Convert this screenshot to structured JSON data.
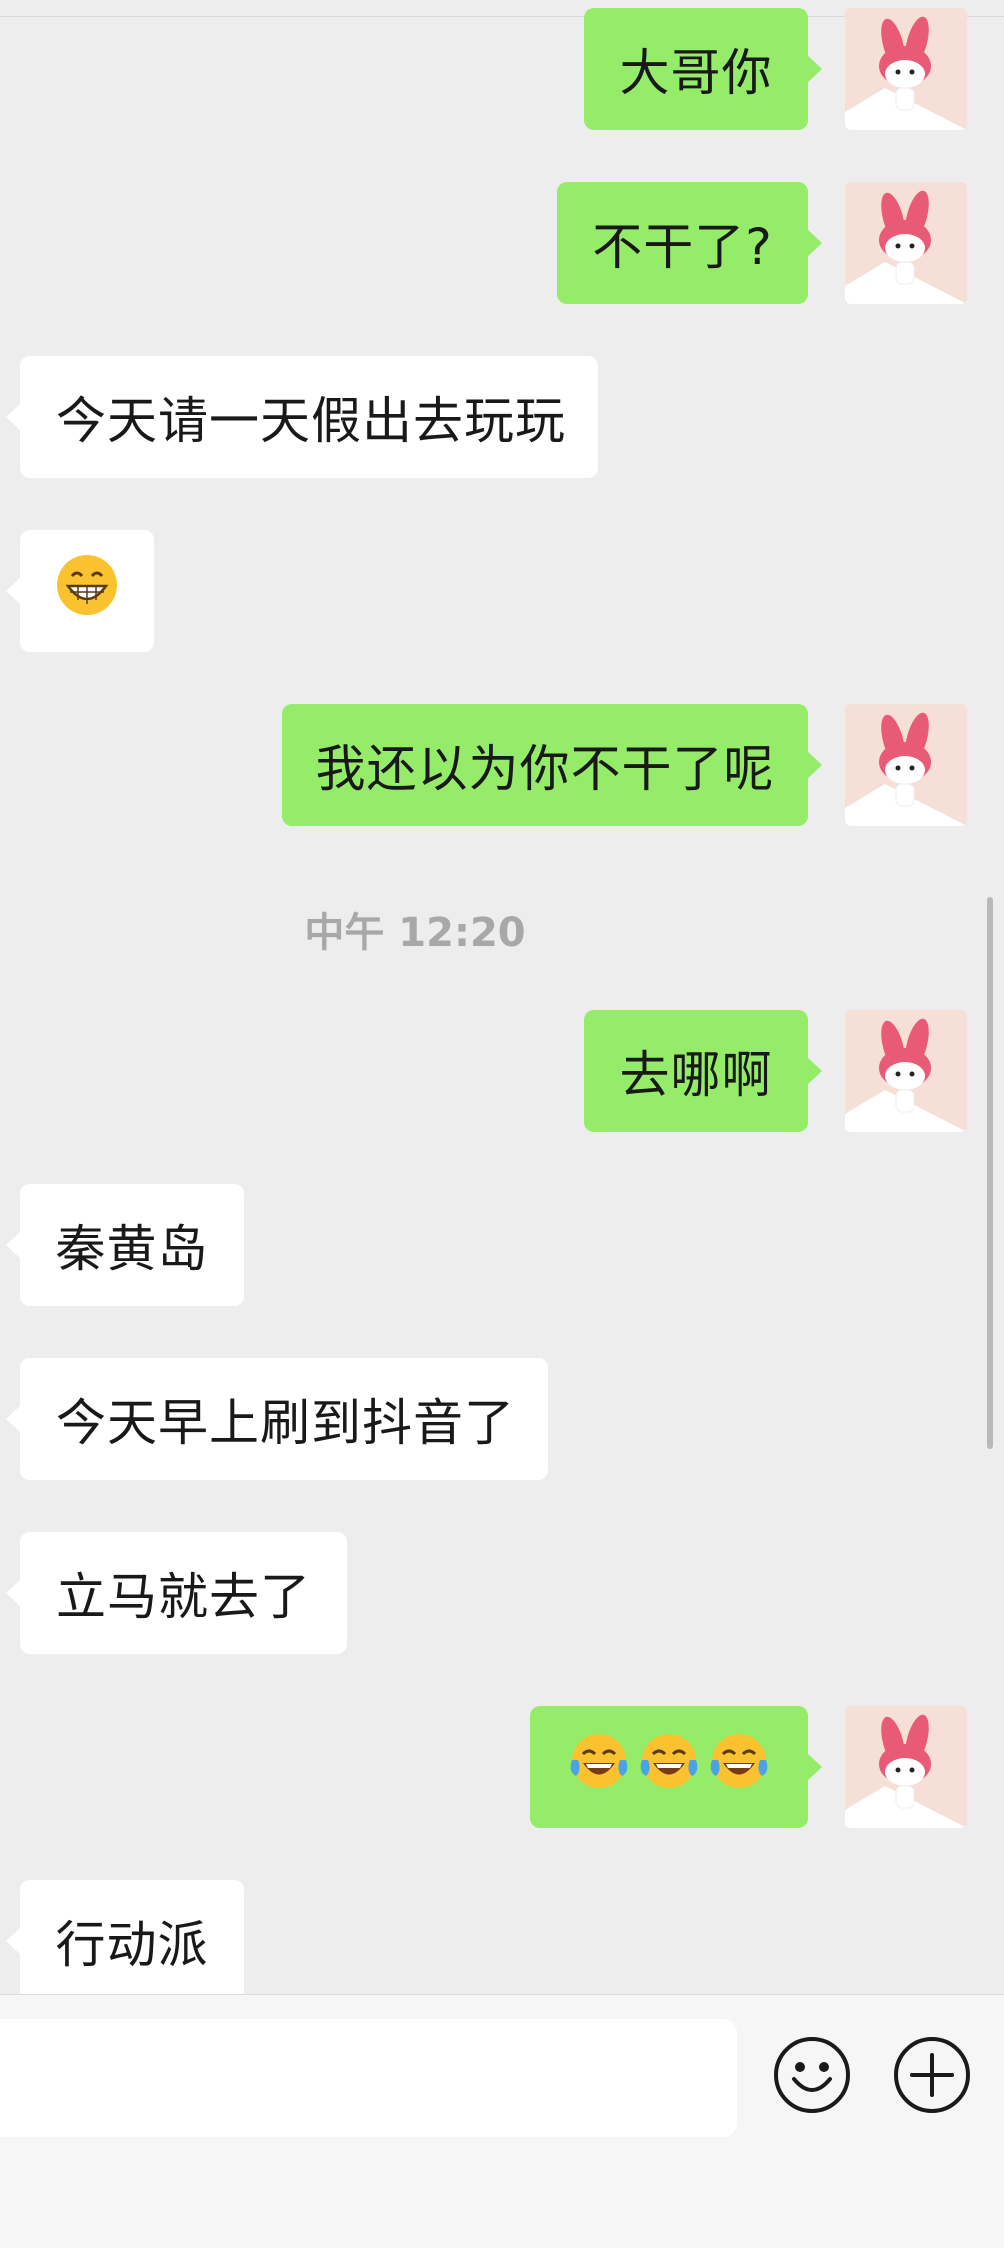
{
  "chat": {
    "messages": [
      {
        "side": "me",
        "text": "大哥你"
      },
      {
        "side": "me",
        "text": "不干了?"
      },
      {
        "side": "them",
        "text": "今天请一天假出去玩玩"
      },
      {
        "side": "them",
        "emoji": "grin-emoji"
      },
      {
        "side": "me",
        "text": "我还以为你不干了呢"
      },
      {
        "side": "me",
        "text": "去哪啊"
      },
      {
        "side": "them",
        "text": "秦黄岛"
      },
      {
        "side": "them",
        "text": "今天早上刷到抖音了"
      },
      {
        "side": "them",
        "text": "立马就去了"
      },
      {
        "side": "me",
        "emoji": "tears-of-joy-emoji",
        "count": 3
      },
      {
        "side": "them",
        "text": "行动派"
      }
    ],
    "timestamp": "中午 12:20"
  },
  "input_bar": {
    "value": "",
    "emoji_button_icon": "smiley-icon",
    "more_button_icon": "plus-circle-icon"
  },
  "colors": {
    "me_bubble": "#95ec69",
    "them_bubble": "#ffffff",
    "background": "#ededed"
  }
}
